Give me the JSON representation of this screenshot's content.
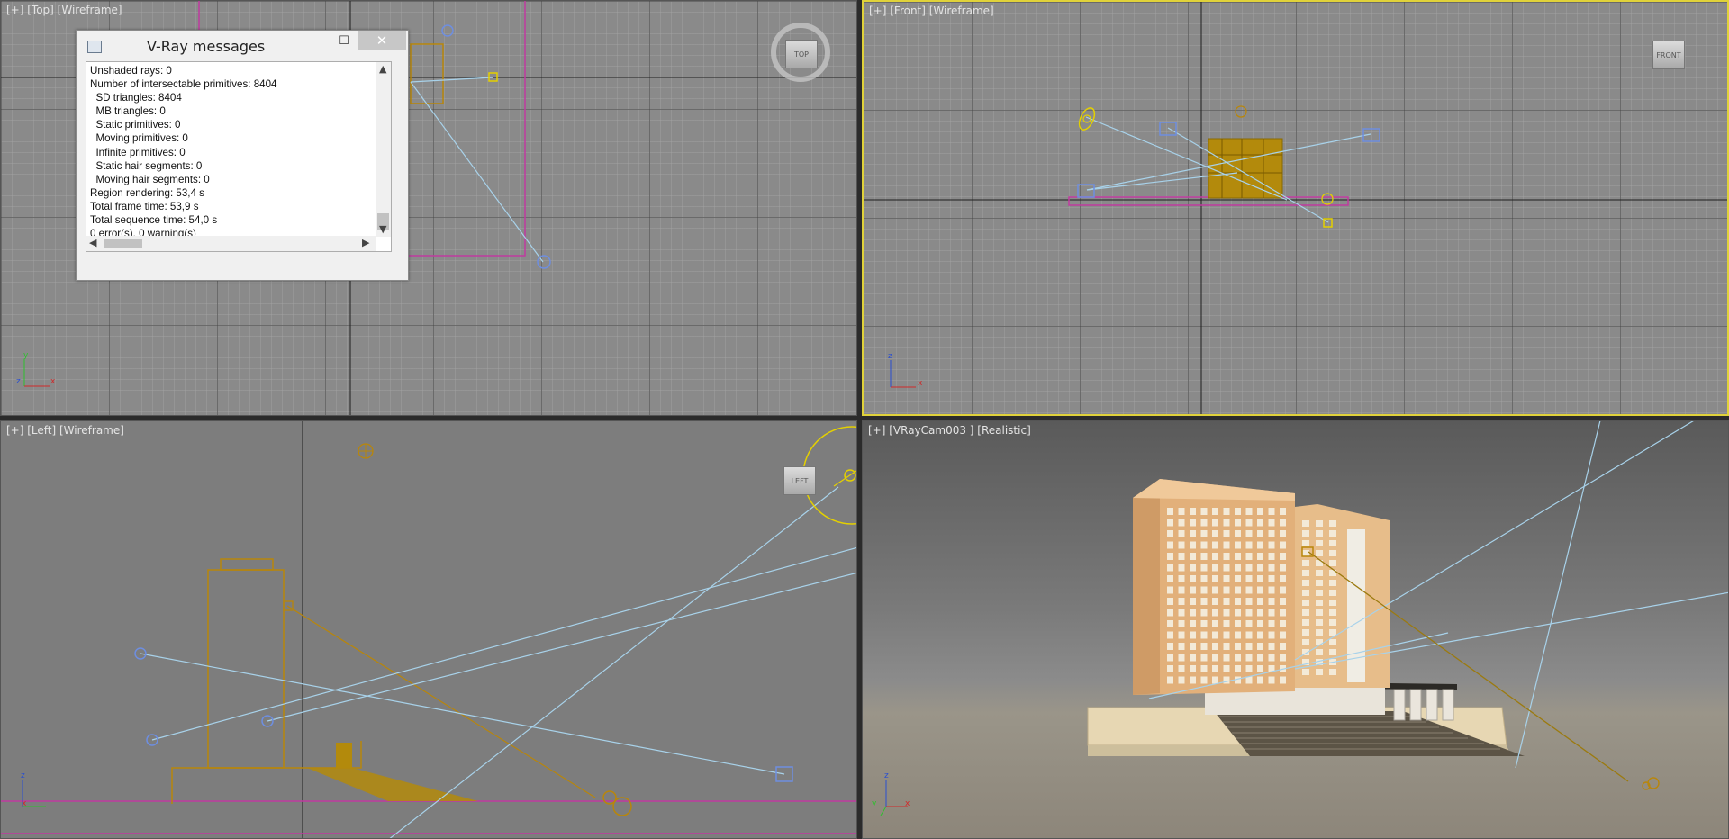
{
  "viewports": {
    "top": {
      "label": "[+] [Top] [Wireframe]",
      "cube": "TOP"
    },
    "front": {
      "label": "[+] [Front] [Wireframe]",
      "cube": "FRONT"
    },
    "left": {
      "label": "[+] [Left] [Wireframe]",
      "cube": "LEFT"
    },
    "camera": {
      "label": "[+] [VRayCam003 ] [Realistic]"
    }
  },
  "axes": {
    "x": "x",
    "y": "y",
    "z": "z"
  },
  "vray_window": {
    "title": "V-Ray messages",
    "minimize": "—",
    "maximize": "☐",
    "close": "✕",
    "lines": [
      "Unshaded rays: 0",
      "Number of intersectable primitives: 8404",
      "  SD triangles: 8404",
      "  MB triangles: 0",
      "  Static primitives: 0",
      "  Moving primitives: 0",
      "  Infinite primitives: 0",
      "  Static hair segments: 0",
      "  Moving hair segments: 0",
      "Region rendering: 53,4 s",
      "Total frame time: 53,9 s",
      "Total sequence time: 54,0 s",
      "0 error(s), 0 warning(s)",
      "=============================="
    ]
  },
  "colors": {
    "active_border": "#e0d23a",
    "wire_light": "#a8d2ea",
    "wire_object": "#b8860b",
    "helper": "#c03aa0"
  }
}
